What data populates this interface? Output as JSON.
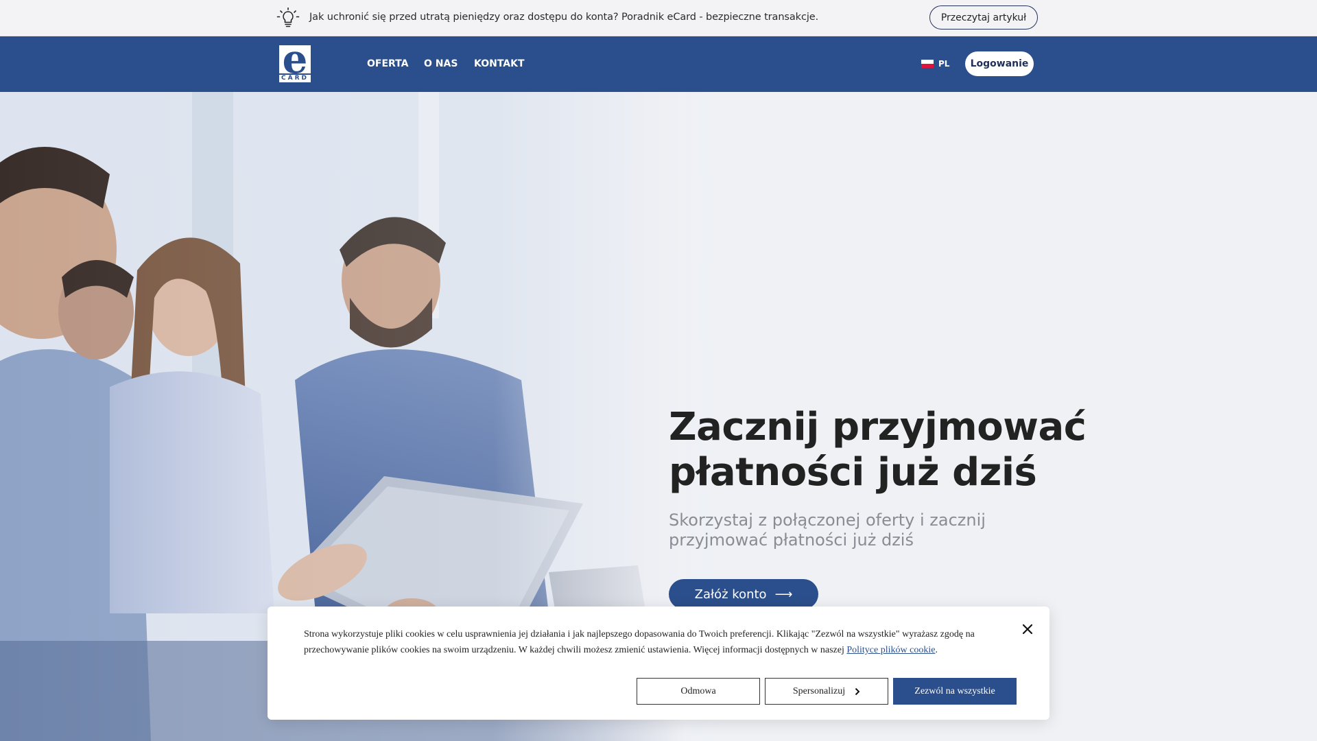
{
  "notice": {
    "text": "Jak uchronić się przed utratą pieniędzy oraz dostępu do konta? Poradnik eCard - bezpieczne transakcje.",
    "button_label": "Przeczytaj artykuł",
    "icon": "lightbulb-icon"
  },
  "nav": {
    "logo_letter": "e",
    "logo_word": "CARD",
    "items": [
      {
        "label": "OFERTA"
      },
      {
        "label": "O NAS"
      },
      {
        "label": "KONTAKT"
      }
    ],
    "language": "PL",
    "login_label": "Logowanie"
  },
  "hero": {
    "title": "Zacznij przyjmować\npłatności już dziś",
    "subtitle": "Skorzystaj z połączonej oferty i zacznij przyjmować płatności już dziś",
    "cta_label": "Załóż konto",
    "cta_arrow": "⟶"
  },
  "cookie": {
    "message": "Strona wykorzystuje pliki cookies w celu usprawnienia jej działania i jak najlepszego dopasowania do Twoich preferencji. Klikając \"Zezwól na wszystkie\" wyrażasz zgodę na przechowywanie plików cookies na swoim urządzeniu. W każdej chwili możesz zmienić ustawienia. Więcej informacji dostępnych w naszej",
    "link_text": "Polityce plików cookie",
    "link_suffix": ".",
    "deny_label": "Odmowa",
    "customize_label": "Spersonalizuj",
    "allow_label": "Zezwól na wszystkie"
  },
  "colors": {
    "brand": "#2b4f8c",
    "notice_bg": "#f3f3f5",
    "hero_bg": "#f0f1f5"
  }
}
